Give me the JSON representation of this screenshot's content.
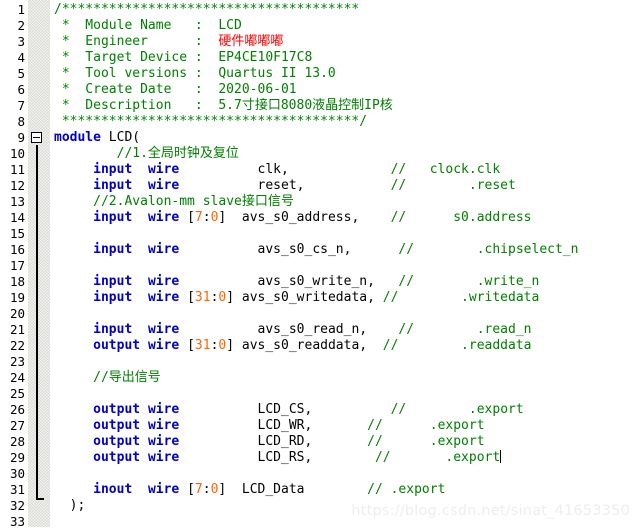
{
  "editor": {
    "title": "verilog-source-view",
    "language": "Verilog",
    "first_line": 1,
    "last_line": 33,
    "total_visible_lines": 33,
    "colors": {
      "background": "#ffffff",
      "line_number_text": "#000000",
      "fold_margin": "#f4f4f2",
      "comment": "#008000",
      "keyword": "#0000cc",
      "identifier": "#000000",
      "number": "#ff6600",
      "cjk_highlight_red": "#ff0000",
      "watermark": "#eceef0"
    }
  },
  "line_numbers": [
    "1",
    "2",
    "3",
    "4",
    "5",
    "6",
    "7",
    "8",
    "9",
    "10",
    "11",
    "12",
    "13",
    "14",
    "15",
    "16",
    "17",
    "18",
    "19",
    "20",
    "21",
    "22",
    "23",
    "24",
    "25",
    "26",
    "27",
    "28",
    "29",
    "30",
    "31",
    "32",
    "33"
  ],
  "fold": {
    "marker_line": 9,
    "marker_type": "collapse-minus-box",
    "guide_end_line": 33
  },
  "caret": {
    "line": 29,
    "after_text": ".export"
  },
  "watermark": {
    "text": "https://blog.csdn.net/sinat_41653350"
  },
  "lines": [
    {
      "n": "1",
      "text": "/**************************************"
    },
    {
      "n": "2",
      "text": " *  Module Name   :  LCD"
    },
    {
      "n": "3",
      "text": " *  Engineer      :  硬件嘟嘟嘟"
    },
    {
      "n": "4",
      "text": " *  Target Device :  EP4CE10F17C8"
    },
    {
      "n": "5",
      "text": " *  Tool versions :  Quartus II 13.0"
    },
    {
      "n": "6",
      "text": " *  Create Date   :  2020-06-01"
    },
    {
      "n": "7",
      "text": " *  Description   :  5.7寸接口8080液晶控制IP核"
    },
    {
      "n": "8",
      "text": " **************************************/"
    },
    {
      "n": "9",
      "text": "module LCD("
    },
    {
      "n": "10",
      "text": "        //1.全局时钟及复位"
    },
    {
      "n": "11",
      "text": "     input  wire         clk,              //   clock.clk"
    },
    {
      "n": "12",
      "text": "     input  wire         reset,            //        .reset"
    },
    {
      "n": "13",
      "text": "     //2.Avalon-mm slave接口信号"
    },
    {
      "n": "14",
      "text": "     input  wire [7:0]  avs_s0_address,    //      s0.address"
    },
    {
      "n": "15",
      "text": ""
    },
    {
      "n": "16",
      "text": "     input  wire         avs_s0_cs_n,      //        .chipselect_n"
    },
    {
      "n": "17",
      "text": ""
    },
    {
      "n": "18",
      "text": "     input  wire         avs_s0_write_n,   //        .write_n"
    },
    {
      "n": "19",
      "text": "     input  wire [31:0] avs_s0_writedata, //        .writedata"
    },
    {
      "n": "20",
      "text": ""
    },
    {
      "n": "21",
      "text": "     input  wire         avs_s0_read_n,    //        .read_n"
    },
    {
      "n": "22",
      "text": "     output wire [31:0] avs_s0_readdata,  //        .readdata"
    },
    {
      "n": "23",
      "text": ""
    },
    {
      "n": "24",
      "text": "     //导出信号"
    },
    {
      "n": "25",
      "text": ""
    },
    {
      "n": "26",
      "text": "     output wire         LCD_CS,          //        .export"
    },
    {
      "n": "27",
      "text": "     output wire         LCD_WR,       //       .export"
    },
    {
      "n": "28",
      "text": "     output wire         LCD_RD,       //       .export"
    },
    {
      "n": "29",
      "text": "     output wire         LCD_RS,        //        .export"
    },
    {
      "n": "30",
      "text": ""
    },
    {
      "n": "31",
      "text": "     inout  wire [7:0]  LCD_Data        // .export"
    },
    {
      "n": "32",
      "text": "  );"
    },
    {
      "n": "33",
      "text": ""
    }
  ],
  "tokens": {
    "l1": [
      {
        "c": "t-comment",
        "s": "/**************************************"
      }
    ],
    "l2": [
      {
        "c": "t-comment",
        "s": " *  Module Name   :  LCD"
      }
    ],
    "l3a": [
      {
        "c": "t-comment",
        "s": " *  Engineer      :  "
      }
    ],
    "l3b": [
      {
        "c": "t-cjk-red",
        "s": "硬件嘟嘟嘟"
      }
    ],
    "l4": [
      {
        "c": "t-comment",
        "s": " *  Target Device :  EP4CE10F17C8"
      }
    ],
    "l5": [
      {
        "c": "t-comment",
        "s": " *  Tool versions :  Quartus II 13.0"
      }
    ],
    "l6": [
      {
        "c": "t-comment",
        "s": " *  Create Date   :  2020-06-01"
      }
    ],
    "l7": [
      {
        "c": "t-comment",
        "s": " *  Description   :  5.7寸接口8080液晶控制IP核"
      }
    ],
    "l8": [
      {
        "c": "t-comment",
        "s": " **************************************/"
      }
    ],
    "keywords": {
      "module": "module",
      "input": "input",
      "output": "output",
      "inout": "inout",
      "wire": "wire"
    },
    "identifiers": {
      "module_name": "LCD(",
      "clk": "clk,",
      "reset": "reset,",
      "avs_s0_address": "avs_s0_address,",
      "avs_s0_cs_n": "avs_s0_cs_n,",
      "avs_s0_write_n": "avs_s0_write_n,",
      "avs_s0_writedata": "avs_s0_writedata,",
      "avs_s0_read_n": "avs_s0_read_n,",
      "avs_s0_readdata": "avs_s0_readdata,",
      "lcd_cs": "LCD_CS,",
      "lcd_wr": "LCD_WR,",
      "lcd_rd": "LCD_RD,",
      "lcd_rs": "LCD_RS,",
      "lcd_data": "LCD_Data",
      "close_paren": ");"
    },
    "ranges": {
      "r7_0_open": "[",
      "r7_0_hi": "7",
      "r7_0_colon": ":",
      "r7_0_lo": "0",
      "r7_0_close": "]",
      "r31_0_hi": "31",
      "r31_0_lo": "0"
    },
    "comments": {
      "c10": "//1.全局时钟及复位",
      "c13": "//2.Avalon-mm slave接口信号",
      "c24": "//导出信号",
      "slashes": "//",
      "clock_clk": "clock.clk",
      "dot_reset": ".reset",
      "s0_address": "s0.address",
      "dot_chipselect_n": ".chipselect_n",
      "dot_write_n": ".write_n",
      "dot_writedata": ".writedata",
      "dot_read_n": ".read_n",
      "dot_readdata": ".readdata",
      "dot_export": ".export"
    }
  }
}
